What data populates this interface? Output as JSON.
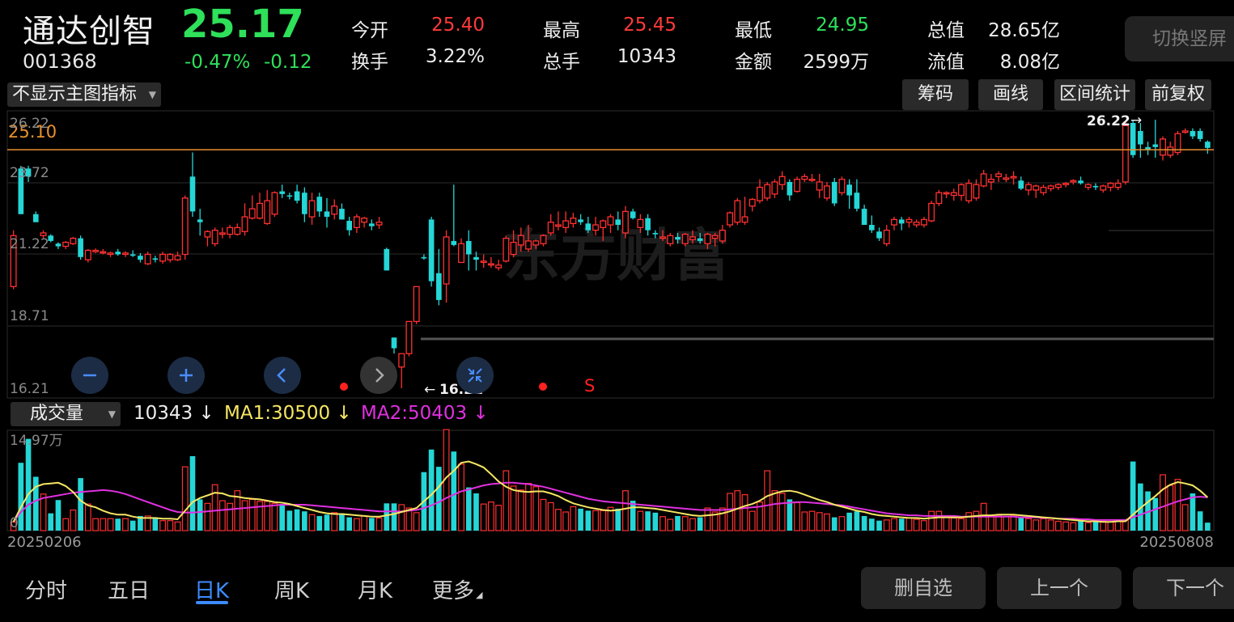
{
  "header": {
    "name": "通达创智",
    "code": "001368",
    "price": "25.17",
    "change_pct": "-0.47%",
    "change_amt": "-0.12",
    "switch_label": "切换竖屏",
    "stats": [
      {
        "label": "今开",
        "value": "25.40",
        "color": "#ff3a3a"
      },
      {
        "label": "换手",
        "value": "3.22%",
        "color": "#ededed"
      },
      {
        "label": "最高",
        "value": "25.45",
        "color": "#ff3a3a"
      },
      {
        "label": "总手",
        "value": "10343",
        "color": "#ededed"
      },
      {
        "label": "最低",
        "value": "24.95",
        "color": "#2ee05a"
      },
      {
        "label": "金额",
        "value": "2599万",
        "color": "#ededed"
      },
      {
        "label": "总值",
        "value": "28.65亿",
        "color": "#ededed"
      },
      {
        "label": "流值",
        "value": "8.08亿",
        "color": "#ededed"
      }
    ]
  },
  "toolbar": {
    "indicator_label": "不显示主图指标",
    "chips_label": "筹码",
    "draw_label": "画线",
    "range_label": "区间统计",
    "adjust_label": "前复权"
  },
  "price_chart": {
    "y_labels": [
      "26.22",
      "23.72",
      "21.22",
      "18.71",
      "16.21"
    ],
    "ref_line_label": "25.10",
    "high_label": "26.22",
    "low_label": "16.21",
    "signal_label": "S",
    "watermark": "东方财富",
    "colors": {
      "up": "#ff3030",
      "down": "#25d6d6",
      "ref": "#e8912e"
    }
  },
  "volume": {
    "selector_label": "成交量",
    "current": "10343",
    "ma1": "MA1:30500",
    "ma2": "MA2:50403",
    "max_label": "14.97万",
    "zero_label": "0",
    "start_date": "20250206",
    "end_date": "20250808",
    "colors": {
      "ma1": "#f5e663",
      "ma2": "#e030e0"
    }
  },
  "tabs": [
    "分时",
    "五日",
    "日K",
    "周K",
    "月K",
    "更多"
  ],
  "active_tab": "日K",
  "bottom_buttons": {
    "remove": "删自选",
    "prev": "上一个",
    "next": "下一个"
  },
  "chart_data": {
    "type": "candlestick",
    "ylim": [
      16.21,
      26.22
    ],
    "ref_line": 25.1,
    "ohlc": [
      [
        20.0,
        22.1,
        19.9,
        21.9
      ],
      [
        24.4,
        24.5,
        22.7,
        22.7
      ],
      [
        24.4,
        24.5,
        23.9,
        24.1
      ],
      [
        22.7,
        22.8,
        22.4,
        22.4
      ],
      [
        21.9,
        22.1,
        21.8,
        22.0
      ],
      [
        21.9,
        21.95,
        21.65,
        21.7
      ],
      [
        21.6,
        21.65,
        21.4,
        21.5
      ],
      [
        21.5,
        21.7,
        21.4,
        21.65
      ],
      [
        21.6,
        21.85,
        21.55,
        21.8
      ],
      [
        21.8,
        21.9,
        21.0,
        21.1
      ],
      [
        21.0,
        21.4,
        20.9,
        21.35
      ],
      [
        21.3,
        21.42,
        21.25,
        21.35
      ],
      [
        21.3,
        21.4,
        21.2,
        21.3
      ],
      [
        21.2,
        21.3,
        21.1,
        21.25
      ],
      [
        21.3,
        21.4,
        21.15,
        21.2
      ],
      [
        21.2,
        21.32,
        21.1,
        21.25
      ],
      [
        21.2,
        21.35,
        21.1,
        21.15
      ],
      [
        21.15,
        21.25,
        20.9,
        21.0
      ],
      [
        20.85,
        21.3,
        20.8,
        21.2
      ],
      [
        21.05,
        21.15,
        20.9,
        21.0
      ],
      [
        20.95,
        21.3,
        20.85,
        21.2
      ],
      [
        21.0,
        21.25,
        20.9,
        21.2
      ],
      [
        21.0,
        21.3,
        20.95,
        21.15
      ],
      [
        21.2,
        23.4,
        21.0,
        23.3
      ],
      [
        24.1,
        25.0,
        22.6,
        22.8
      ],
      [
        22.5,
        22.9,
        21.9,
        22.4
      ],
      [
        21.85,
        22.1,
        21.5,
        22.05
      ],
      [
        21.6,
        22.2,
        21.5,
        22.1
      ],
      [
        21.95,
        22.2,
        21.8,
        22.0
      ],
      [
        21.95,
        22.3,
        21.8,
        22.2
      ],
      [
        21.95,
        22.35,
        21.9,
        22.2
      ],
      [
        22.05,
        23.1,
        21.9,
        22.6
      ],
      [
        22.55,
        23.4,
        22.5,
        22.9
      ],
      [
        22.55,
        23.5,
        22.5,
        23.1
      ],
      [
        22.35,
        23.6,
        22.3,
        23.2
      ],
      [
        22.7,
        23.55,
        22.6,
        23.5
      ],
      [
        23.55,
        23.8,
        23.3,
        23.45
      ],
      [
        23.4,
        23.5,
        23.25,
        23.35
      ],
      [
        23.55,
        23.8,
        23.1,
        23.2
      ],
      [
        23.5,
        23.7,
        22.4,
        22.7
      ],
      [
        22.6,
        23.5,
        22.3,
        23.2
      ],
      [
        23.35,
        23.5,
        22.6,
        22.8
      ],
      [
        22.8,
        23.3,
        22.2,
        22.6
      ],
      [
        22.7,
        23.25,
        22.5,
        23.0
      ],
      [
        22.9,
        23.1,
        22.5,
        22.5
      ],
      [
        22.45,
        22.6,
        21.9,
        22.1
      ],
      [
        22.2,
        22.7,
        22.0,
        22.6
      ],
      [
        22.4,
        22.6,
        22.2,
        22.55
      ],
      [
        22.35,
        22.5,
        22.1,
        22.25
      ],
      [
        22.3,
        22.6,
        22.15,
        22.4
      ],
      [
        21.4,
        21.45,
        20.6,
        20.6
      ],
      [
        18.1,
        18.1,
        17.5,
        17.7
      ],
      [
        17.0,
        17.5,
        16.21,
        17.5
      ],
      [
        17.5,
        18.7,
        17.4,
        18.7
      ],
      [
        18.7,
        20.0,
        18.6,
        20.0
      ],
      [
        21.1,
        21.2,
        21.0,
        21.05
      ],
      [
        22.5,
        22.6,
        20.0,
        20.2
      ],
      [
        20.5,
        21.4,
        19.3,
        19.5
      ],
      [
        20.1,
        22.1,
        19.4,
        21.85
      ],
      [
        21.7,
        23.8,
        21.5,
        21.55
      ],
      [
        20.9,
        21.8,
        20.9,
        21.6
      ],
      [
        21.7,
        22.1,
        20.6,
        21.2
      ],
      [
        21.1,
        21.3,
        20.6,
        21.0
      ],
      [
        20.9,
        21.2,
        20.7,
        20.95
      ],
      [
        20.85,
        21.1,
        20.7,
        20.85
      ],
      [
        20.7,
        21.0,
        20.6,
        20.8
      ],
      [
        20.95,
        21.9,
        20.9,
        21.8
      ],
      [
        21.2,
        22.1,
        21.1,
        21.65
      ],
      [
        21.55,
        22.2,
        21.3,
        21.9
      ],
      [
        21.4,
        22.3,
        21.3,
        21.7
      ],
      [
        21.55,
        21.75,
        21.4,
        21.7
      ],
      [
        21.6,
        21.95,
        21.5,
        21.9
      ],
      [
        22.0,
        22.7,
        21.9,
        22.4
      ],
      [
        22.25,
        22.8,
        22.1,
        22.3
      ],
      [
        22.2,
        22.8,
        22.0,
        22.45
      ],
      [
        22.35,
        22.75,
        22.2,
        22.55
      ],
      [
        22.5,
        22.7,
        22.3,
        22.4
      ],
      [
        22.35,
        22.6,
        22.0,
        22.1
      ],
      [
        22.1,
        22.6,
        21.9,
        22.3
      ],
      [
        22.2,
        22.5,
        21.7,
        22.45
      ],
      [
        22.3,
        22.7,
        22.0,
        22.6
      ],
      [
        22.5,
        22.8,
        22.1,
        22.3
      ],
      [
        22.0,
        23.0,
        21.8,
        22.8
      ],
      [
        22.8,
        22.9,
        22.5,
        22.55
      ],
      [
        22.2,
        22.7,
        22.0,
        22.5
      ],
      [
        22.55,
        22.7,
        21.9,
        22.1
      ],
      [
        22.0,
        22.1,
        21.8,
        21.95
      ],
      [
        21.8,
        22.1,
        21.7,
        21.85
      ],
      [
        21.6,
        22.0,
        21.5,
        21.9
      ],
      [
        21.85,
        22.0,
        21.6,
        21.75
      ],
      [
        21.6,
        22.0,
        21.5,
        21.95
      ],
      [
        21.75,
        22.1,
        21.6,
        21.85
      ],
      [
        21.8,
        22.0,
        21.6,
        21.7
      ],
      [
        21.6,
        22.0,
        21.4,
        21.95
      ],
      [
        21.8,
        22.0,
        21.5,
        21.9
      ],
      [
        21.7,
        22.3,
        21.6,
        22.1
      ],
      [
        22.3,
        22.8,
        22.2,
        22.75
      ],
      [
        22.4,
        23.3,
        22.3,
        23.2
      ],
      [
        22.4,
        23.35,
        22.3,
        22.6
      ],
      [
        23.0,
        23.3,
        22.8,
        23.25
      ],
      [
        23.2,
        24.0,
        23.1,
        23.7
      ],
      [
        23.3,
        23.9,
        23.2,
        23.8
      ],
      [
        23.45,
        24.0,
        23.3,
        23.9
      ],
      [
        23.8,
        24.3,
        23.6,
        24.1
      ],
      [
        23.9,
        24.0,
        23.2,
        23.4
      ],
      [
        23.55,
        24.1,
        23.5,
        24.0
      ],
      [
        24.0,
        24.2,
        23.9,
        24.1
      ],
      [
        24.0,
        24.2,
        23.9,
        24.0
      ],
      [
        23.6,
        24.2,
        23.3,
        23.9
      ],
      [
        23.3,
        23.9,
        23.2,
        23.75
      ],
      [
        23.9,
        24.05,
        23.0,
        23.1
      ],
      [
        23.5,
        24.1,
        23.4,
        24.0
      ],
      [
        23.8,
        24.0,
        22.9,
        23.4
      ],
      [
        23.5,
        24.0,
        22.8,
        22.9
      ],
      [
        22.9,
        23.05,
        22.3,
        22.3
      ],
      [
        22.3,
        22.65,
        22.0,
        22.1
      ],
      [
        22.05,
        22.2,
        21.7,
        21.8
      ],
      [
        21.6,
        22.3,
        21.5,
        22.1
      ],
      [
        22.3,
        22.6,
        22.1,
        22.5
      ],
      [
        22.5,
        22.6,
        22.1,
        22.35
      ],
      [
        22.4,
        22.6,
        22.2,
        22.5
      ],
      [
        22.3,
        22.5,
        22.2,
        22.4
      ],
      [
        22.3,
        22.6,
        22.2,
        22.5
      ],
      [
        22.45,
        23.2,
        22.4,
        23.1
      ],
      [
        23.1,
        23.6,
        23.0,
        23.5
      ],
      [
        23.5,
        23.55,
        23.3,
        23.5
      ],
      [
        23.4,
        23.65,
        23.2,
        23.5
      ],
      [
        23.4,
        23.85,
        23.2,
        23.8
      ],
      [
        23.2,
        24.0,
        23.1,
        23.85
      ],
      [
        23.3,
        24.0,
        23.2,
        23.8
      ],
      [
        23.75,
        24.35,
        23.7,
        24.2
      ],
      [
        23.9,
        24.2,
        23.6,
        24.0
      ],
      [
        24.1,
        24.3,
        23.9,
        24.2
      ],
      [
        24.0,
        24.2,
        23.9,
        24.05
      ],
      [
        24.05,
        24.3,
        23.8,
        24.1
      ],
      [
        23.95,
        24.1,
        23.6,
        23.65
      ],
      [
        23.6,
        23.9,
        23.4,
        23.8
      ],
      [
        23.6,
        23.8,
        23.3,
        23.75
      ],
      [
        23.5,
        23.8,
        23.4,
        23.7
      ],
      [
        23.65,
        23.8,
        23.55,
        23.75
      ],
      [
        23.7,
        23.85,
        23.6,
        23.8
      ],
      [
        23.8,
        23.9,
        23.7,
        23.85
      ],
      [
        23.9,
        24.0,
        23.8,
        23.95
      ],
      [
        23.95,
        24.1,
        23.8,
        23.85
      ],
      [
        23.7,
        23.85,
        23.6,
        23.8
      ],
      [
        23.75,
        23.85,
        23.6,
        23.7
      ],
      [
        23.6,
        23.8,
        23.5,
        23.75
      ],
      [
        23.7,
        23.9,
        23.55,
        23.85
      ],
      [
        23.7,
        24.0,
        23.6,
        23.85
      ],
      [
        23.9,
        26.2,
        23.8,
        26.0
      ],
      [
        26.1,
        26.22,
        24.8,
        24.9
      ],
      [
        25.8,
        26.1,
        24.8,
        25.3
      ],
      [
        25.2,
        25.4,
        24.9,
        25.1
      ],
      [
        25.3,
        26.22,
        24.8,
        25.2
      ],
      [
        24.9,
        25.6,
        24.7,
        25.5
      ],
      [
        24.9,
        25.4,
        24.8,
        25.2
      ],
      [
        25.0,
        25.8,
        24.9,
        25.7
      ],
      [
        25.75,
        25.9,
        25.7,
        25.8
      ],
      [
        25.8,
        25.9,
        25.5,
        25.6
      ],
      [
        25.8,
        25.9,
        25.4,
        25.5
      ],
      [
        25.4,
        25.45,
        24.95,
        25.17
      ]
    ],
    "volume": [
      1.3,
      10.2,
      13.8,
      8.1,
      5.5,
      2.6,
      4.6,
      1.8,
      3.1,
      7.9,
      4.0,
      1.8,
      1.8,
      1.8,
      1.8,
      1.8,
      1.5,
      2.2,
      2.2,
      2.0,
      1.5,
      1.5,
      1.3,
      9.6,
      11.2,
      4.7,
      4.1,
      6.9,
      4.5,
      4.1,
      6.0,
      4.5,
      4.7,
      4.4,
      4.4,
      4.1,
      4.0,
      3.0,
      3.2,
      2.9,
      2.4,
      2.2,
      2.4,
      2.7,
      2.6,
      2.0,
      1.8,
      2.2,
      1.9,
      1.9,
      4.1,
      4.1,
      3.9,
      3.4,
      2.7,
      8.8,
      12.2,
      9.6,
      15.2,
      11.9,
      10.0,
      6.5,
      5.6,
      4.0,
      4.3,
      3.8,
      9.0,
      6.7,
      6.1,
      7.1,
      6.6,
      4.7,
      4.2,
      3.2,
      2.8,
      3.6,
      3.3,
      3.0,
      3.0,
      3.0,
      3.5,
      3.3,
      6.0,
      4.5,
      2.9,
      2.9,
      2.7,
      2.1,
      1.7,
      2.2,
      2.1,
      1.8,
      2.0,
      3.4,
      2.8,
      3.4,
      5.6,
      6.0,
      5.4,
      2.9,
      4.3,
      9.0,
      6.0,
      5.6,
      4.7,
      4.2,
      2.8,
      2.9,
      2.7,
      2.5,
      2.0,
      2.1,
      2.7,
      2.9,
      2.2,
      1.8,
      1.5,
      1.6,
      1.8,
      1.8,
      1.9,
      1.7,
      1.5,
      2.9,
      2.9,
      2.0,
      1.9,
      1.8,
      2.7,
      2.9,
      4.1,
      2.3,
      2.3,
      2.1,
      2.3,
      2.1,
      1.8,
      1.6,
      1.8,
      1.6,
      1.4,
      1.3,
      1.2,
      1.4,
      1.2,
      1.3,
      1.4,
      1.3,
      1.6,
      1.6,
      10.4,
      7.1,
      5.9,
      4.9,
      8.4,
      6.8,
      7.7,
      3.9,
      5.6,
      2.9,
      1.2
    ],
    "ma1_series": [
      1.3,
      3.5,
      5.5,
      6.6,
      7.0,
      7.1,
      7.2,
      6.7,
      5.8,
      4.5,
      3.8,
      3.5,
      3.0,
      2.6,
      2.4,
      2.4,
      2.1,
      1.9,
      1.9,
      1.9,
      1.8,
      1.8,
      1.7,
      3.0,
      4.3,
      4.9,
      5.3,
      5.7,
      5.6,
      5.2,
      5.1,
      4.9,
      4.8,
      4.7,
      4.5,
      4.3,
      4.2,
      4.0,
      3.7,
      3.4,
      3.1,
      2.8,
      2.6,
      2.5,
      2.5,
      2.4,
      2.3,
      2.2,
      2.1,
      2.1,
      2.3,
      2.5,
      2.8,
      3.1,
      3.4,
      4.4,
      5.4,
      6.6,
      8.0,
      9.0,
      10.2,
      10.4,
      10.0,
      9.5,
      8.5,
      7.4,
      6.6,
      6.1,
      5.9,
      5.8,
      5.9,
      5.9,
      5.6,
      5.2,
      4.6,
      4.1,
      3.8,
      3.5,
      3.3,
      3.1,
      3.0,
      3.1,
      3.3,
      3.5,
      3.5,
      3.4,
      3.3,
      3.1,
      2.9,
      2.7,
      2.5,
      2.3,
      2.2,
      2.3,
      2.4,
      2.6,
      2.9,
      3.3,
      3.7,
      4.0,
      4.5,
      5.2,
      5.6,
      5.9,
      6.0,
      5.8,
      5.4,
      5.0,
      4.6,
      4.3,
      3.9,
      3.6,
      3.3,
      3.0,
      2.8,
      2.5,
      2.3,
      2.2,
      2.1,
      2.0,
      1.9,
      1.9,
      1.8,
      1.9,
      2.0,
      2.0,
      2.0,
      2.0,
      2.1,
      2.2,
      2.3,
      2.3,
      2.4,
      2.4,
      2.4,
      2.3,
      2.2,
      2.1,
      2.0,
      1.9,
      1.8,
      1.7,
      1.6,
      1.5,
      1.4,
      1.4,
      1.3,
      1.3,
      1.4,
      1.4,
      2.4,
      3.4,
      4.3,
      5.2,
      6.2,
      6.9,
      7.3,
      7.1,
      6.8,
      6.0,
      5.0
    ],
    "ma2_series": [
      1.3,
      2.8,
      3.9,
      4.5,
      4.9,
      5.1,
      5.3,
      5.5,
      5.7,
      5.8,
      5.9,
      6.0,
      6.1,
      6.0,
      5.8,
      5.5,
      5.1,
      4.7,
      4.3,
      3.9,
      3.5,
      3.1,
      2.8,
      2.7,
      2.7,
      2.8,
      2.9,
      3.0,
      3.1,
      3.2,
      3.3,
      3.4,
      3.5,
      3.6,
      3.7,
      3.8,
      3.9,
      3.9,
      3.9,
      3.9,
      3.8,
      3.7,
      3.6,
      3.5,
      3.4,
      3.3,
      3.2,
      3.1,
      3.0,
      2.9,
      2.9,
      2.9,
      2.9,
      3.0,
      3.1,
      3.4,
      3.8,
      4.3,
      4.9,
      5.4,
      5.9,
      6.2,
      6.5,
      6.8,
      7.0,
      7.1,
      7.2,
      7.2,
      7.1,
      7.0,
      6.8,
      6.6,
      6.3,
      6.0,
      5.7,
      5.4,
      5.1,
      4.8,
      4.6,
      4.4,
      4.3,
      4.2,
      4.1,
      4.0,
      3.9,
      3.8,
      3.7,
      3.6,
      3.5,
      3.4,
      3.3,
      3.2,
      3.1,
      3.1,
      3.1,
      3.1,
      3.2,
      3.3,
      3.4,
      3.5,
      3.6,
      3.8,
      4.0,
      4.1,
      4.2,
      4.3,
      4.3,
      4.2,
      4.1,
      4.0,
      3.9,
      3.8,
      3.6,
      3.4,
      3.2,
      3.0,
      2.8,
      2.6,
      2.5,
      2.4,
      2.3,
      2.3,
      2.2,
      2.2,
      2.2,
      2.2,
      2.2,
      2.1,
      2.1,
      2.1,
      2.1,
      2.1,
      2.1,
      2.1,
      2.1,
      2.0,
      2.0,
      2.0,
      1.9,
      1.9,
      1.8,
      1.8,
      1.8,
      1.7,
      1.7,
      1.6,
      1.6,
      1.6,
      1.6,
      1.6,
      2.0,
      2.4,
      2.8,
      3.2,
      3.6,
      4.0,
      4.4,
      4.7,
      5.0,
      5.1,
      5.0
    ]
  }
}
